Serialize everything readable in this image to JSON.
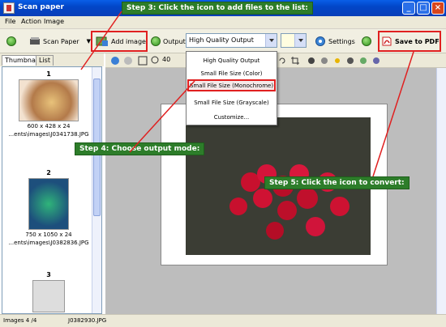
{
  "window": {
    "title": "Scan paper"
  },
  "menu": {
    "items": [
      "File",
      "Action",
      "Image"
    ]
  },
  "toolbar": {
    "scan_paper": "Scan Paper",
    "add_image": "Add image",
    "output_label": "Output:",
    "output_value": "High Quality Output",
    "settings": "Settings",
    "save_to_pdf": "Save to PDF"
  },
  "output_menu": {
    "items": [
      "High Quality Output",
      "Small File Size (Color)",
      "Small File Size (Monochrome)",
      "Small File Size (Grayscale)",
      "Customize..."
    ],
    "selected": "Small File Size (Monochrome)"
  },
  "thumbnail_panel": {
    "tabs": [
      "Thumbnail",
      "List"
    ],
    "items": [
      {
        "number": "1",
        "size": "600 x 428 x 24",
        "path": "...ents\\images\\J0341738.JPG"
      },
      {
        "number": "2",
        "size": "750 x 1050 x 24",
        "path": "...ents\\images\\J0382836.JPG"
      },
      {
        "number": "3",
        "size": "",
        "path": ""
      }
    ]
  },
  "view_toolbar": {
    "zoom": "40"
  },
  "callouts": {
    "step3": "Step 3: Click the icon to add files to the list:",
    "step4": "Step 4: Choose output mode:",
    "step5": "Step 5: Click the icon to convert:"
  },
  "status": {
    "images": "Images 4 /4",
    "file": "J0382930.JPG"
  },
  "colors": {
    "callout_bg": "#2d7d2a",
    "highlight": "#e02020"
  }
}
